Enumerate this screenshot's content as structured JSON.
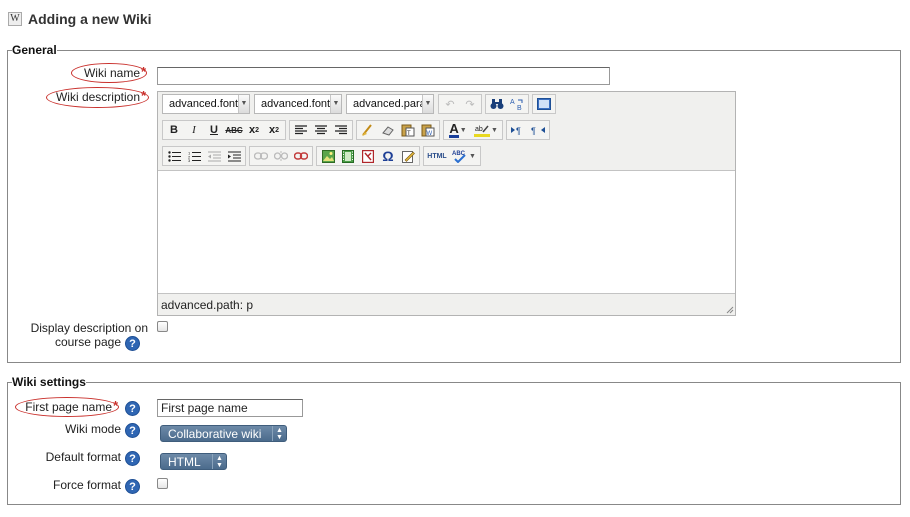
{
  "header": {
    "title": "Adding a new Wiki",
    "icon": "wiki-icon"
  },
  "general": {
    "legend": "General",
    "wiki_name": {
      "label": "Wiki name",
      "value": ""
    },
    "wiki_description": {
      "label": "Wiki description"
    },
    "editor": {
      "font_family_select": "advanced.font",
      "font_size_select": "advanced.font",
      "paragraph_select": "advanced.para",
      "path_text": "advanced.path: p",
      "content": ""
    },
    "display_description": {
      "label_line1": "Display description on",
      "label_line2": "course page",
      "checked": false
    }
  },
  "settings": {
    "legend": "Wiki settings",
    "first_page_name": {
      "label": "First page name",
      "value": "First page name"
    },
    "wiki_mode": {
      "label": "Wiki mode",
      "selected": "Collaborative wiki"
    },
    "default_format": {
      "label": "Default format",
      "selected": "HTML"
    },
    "force_format": {
      "label": "Force format",
      "checked": false
    }
  },
  "colors": {
    "required": "#c9302c",
    "help": "#2f66b3",
    "select": "#4b6b8c"
  }
}
